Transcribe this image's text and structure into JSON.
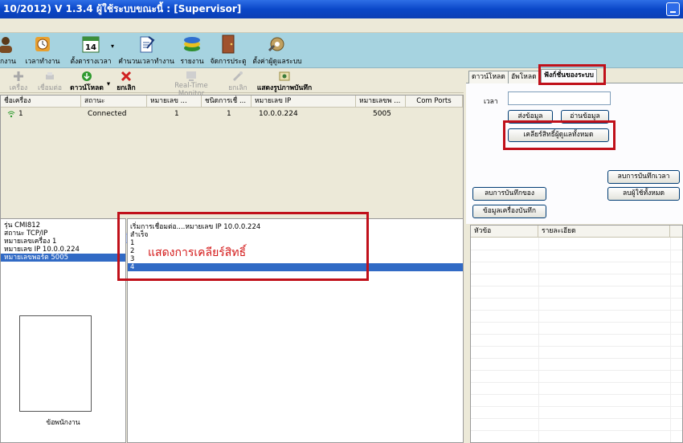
{
  "window": {
    "title": "10/2012) V 1.3.4   ผู้ใช้ระบบขณะนี้ : [Supervisor]"
  },
  "ribbon": {
    "items": [
      {
        "label": "นักงาน",
        "icon": "user-icon"
      },
      {
        "label": "เวลาทำงาน",
        "icon": "clock-icon"
      },
      {
        "label": "ตั้งตารางเวลา",
        "icon": "calendar-icon",
        "badge": "14"
      },
      {
        "label": "คำนวนเวลาทำงาน",
        "icon": "calculate-icon"
      },
      {
        "label": "รายงาน",
        "icon": "chart-icon"
      },
      {
        "label": "จัดการประตู",
        "icon": "door-icon"
      },
      {
        "label": "ตั้งค่าผู้ดูแลระบบ",
        "icon": "admin-settings-icon"
      }
    ]
  },
  "toolbar": {
    "connect": "เครื่อง",
    "disconnect": "เชื่อมต่อ",
    "download": "ดาวน์โหลด",
    "cancel": "ยกเลิก",
    "realtime": "Real-Time Monitor",
    "cancel2": "ยกเลิก",
    "show_photo": "แสดงรูปภาพบันทึก"
  },
  "device_grid": {
    "columns": [
      "ชื่อเครื่อง",
      "สถานะ",
      "หมายเลข ...",
      "ชนิดการเชื่ ...",
      "หมายเลข IP",
      "หมายเลขพ ...",
      "Com Ports"
    ],
    "rows": [
      {
        "name": "1",
        "status": "Connected",
        "machine_no": "1",
        "conn_type": "1",
        "ip": "10.0.0.224",
        "port": "5005",
        "com": ""
      }
    ]
  },
  "device_info": {
    "model": "รุ่น  CMI812",
    "status": "สถานะ  TCP/IP",
    "machine_no": "หมายเลขเครื่อง  1",
    "ip": "หมายเลข IP   10.0.0.224",
    "port": "หมายเลขพอร์ต  5005",
    "photo_label": "ข้อพนักงาน"
  },
  "log": {
    "lines": [
      "เริ่มการเชื่อมต่อ....หมายเลข IP   10.0.0.224",
      "สำเร็จ",
      "1",
      "2",
      "3",
      "4"
    ]
  },
  "annotation": {
    "text": "แสดงการเคลียร์สิทธิ์"
  },
  "right_panel": {
    "tabs": [
      "ดาวน์โหลด",
      "อัพโหลด",
      "ฟังก์ชั่นของระบบ"
    ],
    "time_label": "เวลา",
    "time_value": "",
    "send_btn": "ส่งข้อมูล",
    "read_btn": "อ่านข้อมูล",
    "clear_admin_btn": "เคลียร์สิทธิ์ผู้ดูแลทั้งหมด",
    "del_time_btn": "ลบการบันทึกเวลา",
    "del_record_btn": "ลบการบันทึกของ",
    "del_all_users_btn": "ลบผู้ใช้ทั้งหมด",
    "record_info_btn": "ข้อมูลเครื่องบันทึก",
    "list_columns": [
      "หัวข้อ",
      "รายละเอียด"
    ]
  },
  "colors": {
    "highlight": "#c0101a",
    "selection": "#316ac5",
    "ribbon": "#a6d3e0"
  }
}
